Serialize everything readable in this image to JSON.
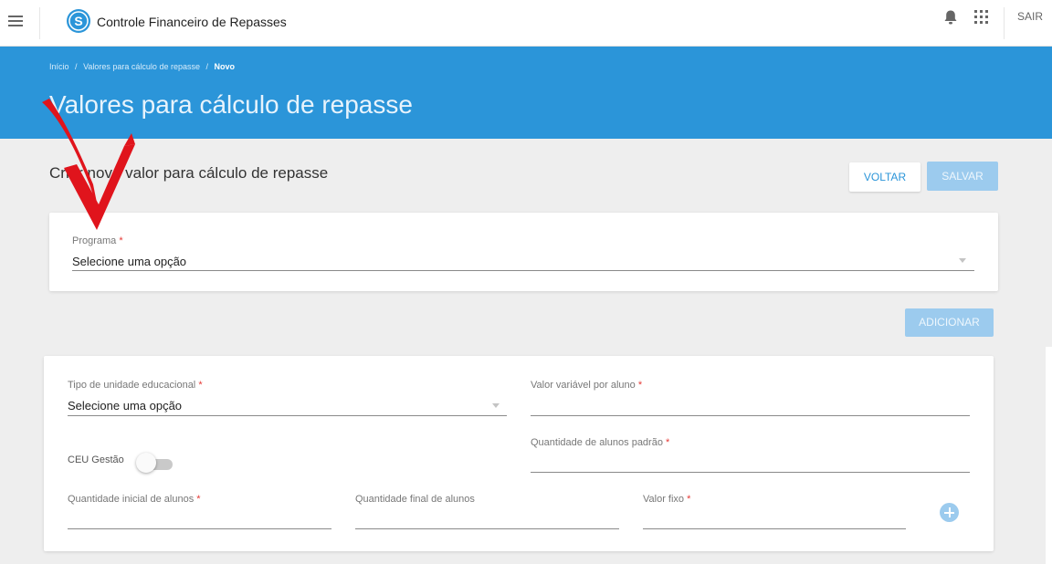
{
  "topbar": {
    "app_title": "Controle Financeiro de Repasses",
    "logo_letter": "S",
    "logout_label": "SAIR",
    "icons": [
      "menu-icon",
      "bell-icon",
      "apps-icon"
    ]
  },
  "header": {
    "breadcrumb": [
      "Início",
      "Valores para cálculo de repasse",
      "Novo"
    ],
    "breadcrumb_separator": "/",
    "title": "Valores para cálculo de repasse",
    "background_color": "#2b95d9"
  },
  "main": {
    "section_title": "Criar novo valor para cálculo de repasse",
    "back_button": "VOLTAR",
    "save_button": "SALVAR",
    "add_button": "ADICIONAR"
  },
  "programa_card": {
    "label": "Programa",
    "required_mark": "*",
    "value": "Selecione uma opção"
  },
  "values_card": {
    "tipo_unidade": {
      "label": "Tipo de unidade educacional",
      "required_mark": "*",
      "value": "Selecione uma opção"
    },
    "valor_variavel": {
      "label": "Valor variável por aluno",
      "required_mark": "*",
      "value": ""
    },
    "ceu_gestao": {
      "label": "CEU Gestão",
      "checked": false
    },
    "qtd_padrao": {
      "label": "Quantidade de alunos padrão",
      "required_mark": "*",
      "value": ""
    },
    "qtd_inicial": {
      "label": "Quantidade inicial de alunos",
      "required_mark": "*",
      "value": ""
    },
    "qtd_final": {
      "label": "Quantidade final de alunos",
      "value": ""
    },
    "valor_fixo": {
      "label": "Valor fixo",
      "required_mark": "*",
      "value": ""
    }
  },
  "colors": {
    "accent": "#2b95d9",
    "disabled_button": "#9ccbee",
    "required": "#e53935",
    "annotation_arrow": "#e0141c"
  }
}
